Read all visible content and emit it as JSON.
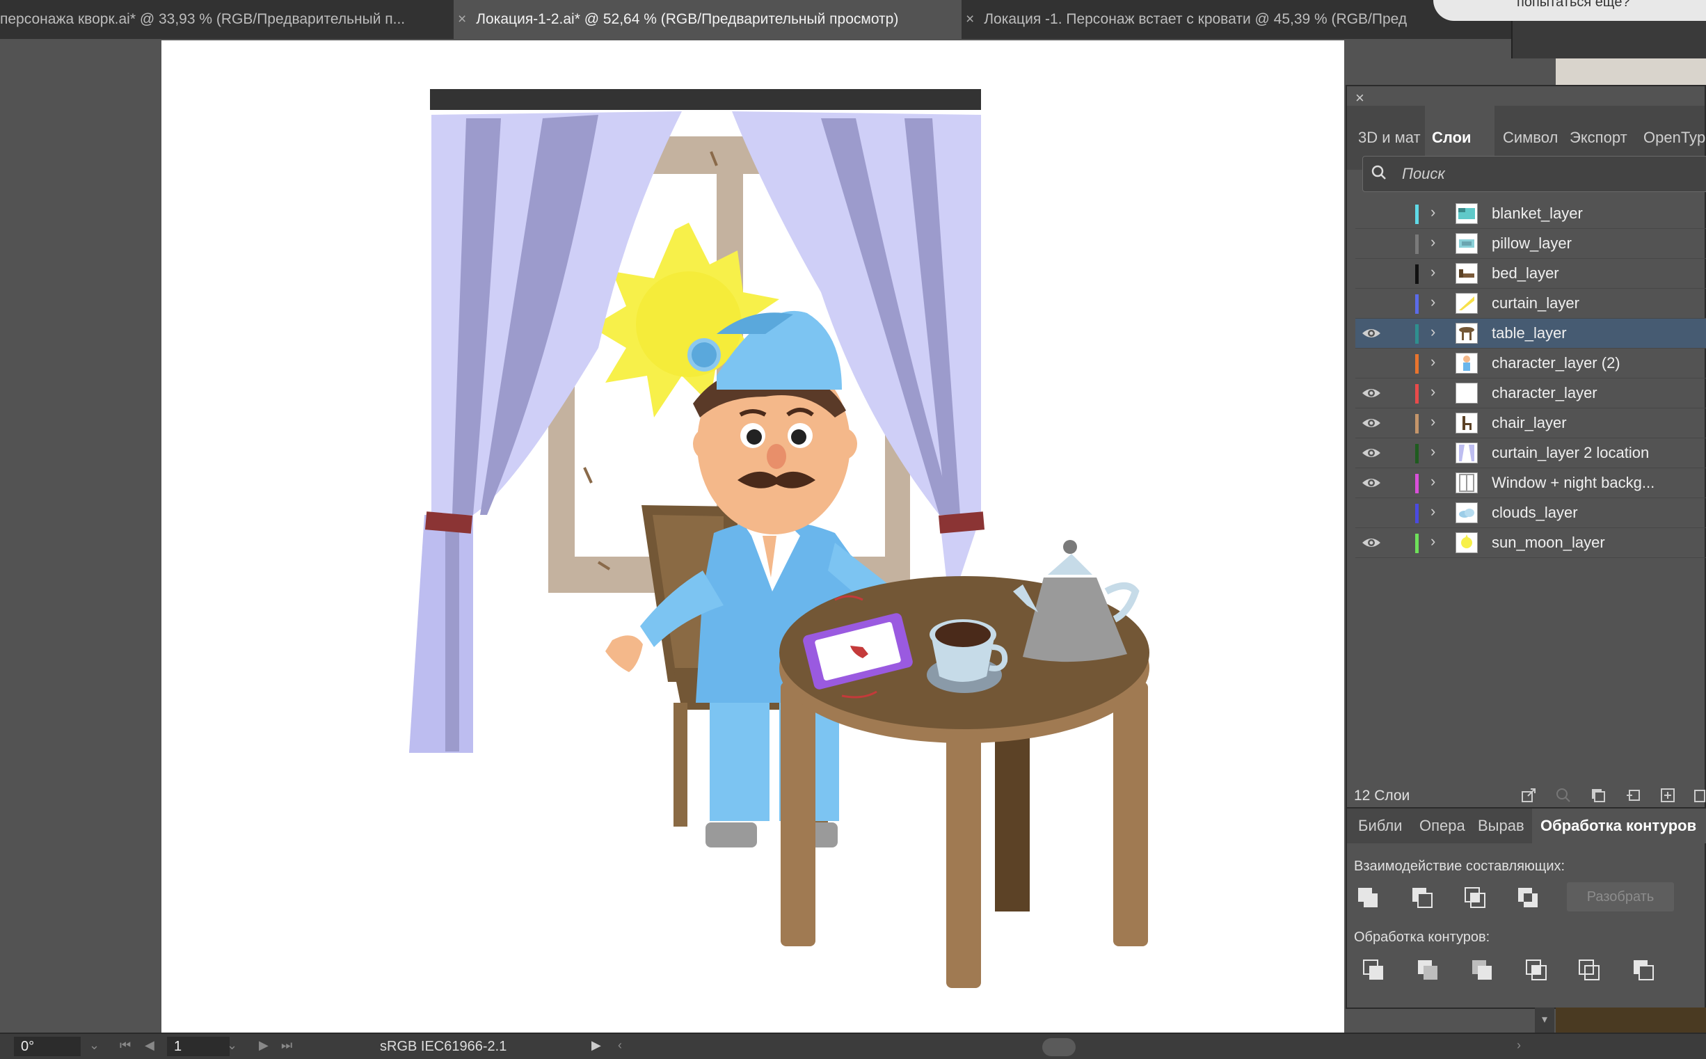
{
  "document_tabs": [
    {
      "label": "персонажа кворк.ai* @ 33,93 % (RGB/Предварительный п...",
      "active": false,
      "close": ""
    },
    {
      "label": "Локация-1-2.ai* @ 52,64 % (RGB/Предварительный просмотр)",
      "active": true,
      "close": "×"
    },
    {
      "label": "Локация -1. Персонаж встает с кровати @ 45,39 % (RGB/Пред",
      "active": false,
      "close": "×"
    }
  ],
  "dialog_fragment_text": "попытаться ещё?",
  "layers_panel": {
    "close": "×",
    "tabs": [
      "3D и мат",
      "Слои",
      "Символ",
      "Экспорт",
      "OpenTyp"
    ],
    "active_tab": "Слои",
    "search_placeholder": "Поиск",
    "layers": [
      {
        "name": "blanket_layer",
        "visible": false,
        "color": "#5fd9e6",
        "thumb": "blanket"
      },
      {
        "name": "pillow_layer",
        "visible": false,
        "color": "#7a7a7a",
        "thumb": "pillow"
      },
      {
        "name": "bed_layer",
        "visible": false,
        "color": "#111111",
        "thumb": "bed"
      },
      {
        "name": "curtain_layer",
        "visible": false,
        "color": "#5b6be8",
        "thumb": "curtain-yellow"
      },
      {
        "name": "table_layer",
        "visible": true,
        "color": "#2f8f8f",
        "thumb": "table",
        "selected": true
      },
      {
        "name": "character_layer (2)",
        "visible": false,
        "color": "#e8742e",
        "thumb": "character"
      },
      {
        "name": "character_layer",
        "visible": true,
        "color": "#e84a4a",
        "thumb": "blank"
      },
      {
        "name": "chair_layer",
        "visible": true,
        "color": "#c4956a",
        "thumb": "chair"
      },
      {
        "name": "curtain_layer 2 location",
        "visible": true,
        "color": "#1f5c1f",
        "thumb": "curtain"
      },
      {
        "name": "Window + night backg...",
        "visible": true,
        "color": "#d94fd9",
        "thumb": "window"
      },
      {
        "name": "clouds_layer",
        "visible": false,
        "color": "#4a4ae0",
        "thumb": "clouds"
      },
      {
        "name": "sun_moon_layer",
        "visible": true,
        "color": "#6ee05a",
        "thumb": "sun"
      }
    ],
    "footer_count": "12 Слои"
  },
  "pathfinder_panel": {
    "tabs": [
      "Библи",
      "Опера",
      "Вырав",
      "Обработка контуров"
    ],
    "active_tab": "Обработка контуров",
    "shape_modes_label": "Взаимодействие составляющих:",
    "expand_button": "Разобрать",
    "pathfinders_label": "Обработка контуров:"
  },
  "statusbar": {
    "rotation": "0°",
    "artboard_number": "1",
    "color_profile": "sRGB IEC61966-2.1"
  },
  "colors": {
    "ui_dark": "#323232",
    "ui_panel": "#535353",
    "selection": "#465b72",
    "curtain": "#cfcff7",
    "curtain_shade": "#9c9bcc",
    "sun": "#f7f04a",
    "pajama": "#7cc4f2",
    "table": "#735736",
    "window_frame": "#c4b29f"
  }
}
